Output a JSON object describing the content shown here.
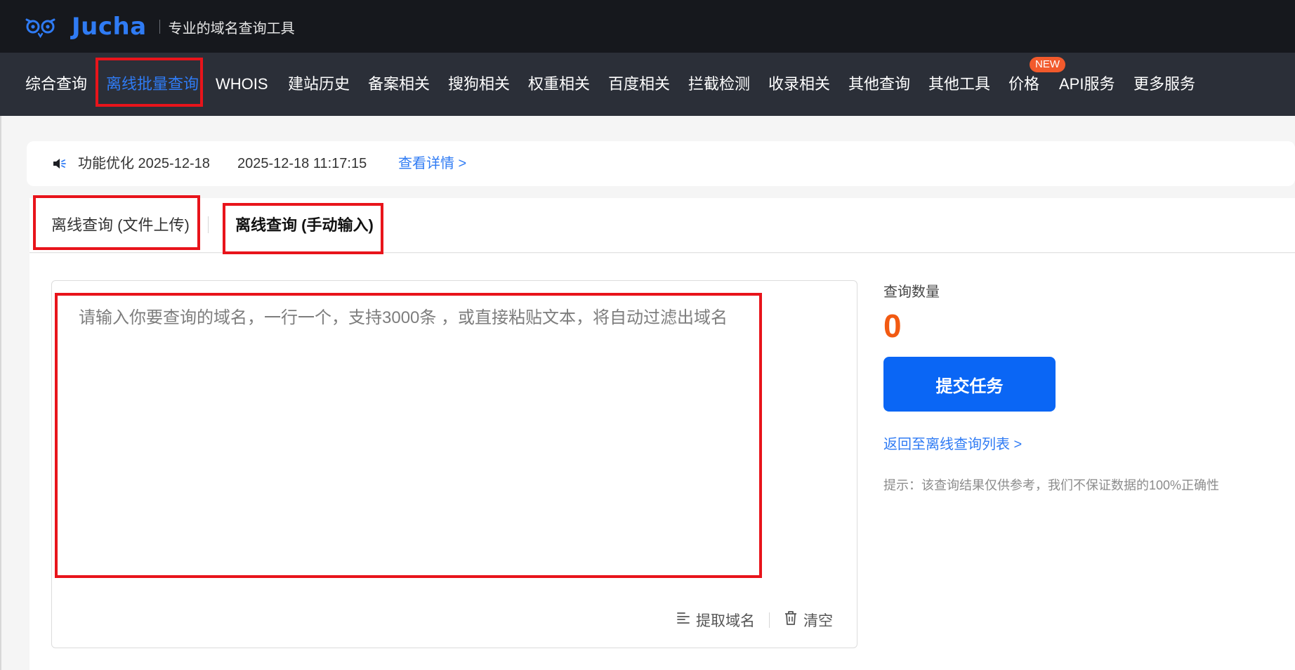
{
  "brand": {
    "name": "Jucha",
    "slogan": "专业的域名查询工具",
    "color": "#2f7bf4"
  },
  "nav": {
    "items": [
      {
        "label": "综合查询",
        "active": false
      },
      {
        "label": "离线批量查询",
        "active": true
      },
      {
        "label": "WHOIS",
        "active": false
      },
      {
        "label": "建站历史",
        "active": false
      },
      {
        "label": "备案相关",
        "active": false
      },
      {
        "label": "搜狗相关",
        "active": false
      },
      {
        "label": "权重相关",
        "active": false
      },
      {
        "label": "百度相关",
        "active": false
      },
      {
        "label": "拦截检测",
        "active": false
      },
      {
        "label": "收录相关",
        "active": false
      },
      {
        "label": "其他查询",
        "active": false
      },
      {
        "label": "其他工具",
        "active": false
      },
      {
        "label": "价格",
        "active": false
      },
      {
        "label": "API服务",
        "active": false
      },
      {
        "label": "更多服务",
        "active": false
      }
    ],
    "badge": "NEW"
  },
  "notice": {
    "icon": "speaker-icon",
    "title": "功能优化 2025-12-18",
    "time": "2025-12-18 11:17:15",
    "link": "查看详情 >"
  },
  "tabs": [
    {
      "label": "离线查询 (文件上传)",
      "selected": false
    },
    {
      "label": "离线查询 (手动输入)",
      "selected": true
    }
  ],
  "input": {
    "placeholder": "请输入你要查询的域名，一行一个，支持3000条 ，或直接粘贴文本，将自动过滤出域名",
    "value": ""
  },
  "actions": {
    "extract": {
      "label": "提取域名",
      "icon": "list-icon"
    },
    "clear": {
      "label": "清空",
      "icon": "trash-icon"
    }
  },
  "side": {
    "count_label": "查询数量",
    "count_value": "0",
    "submit": "提交任务",
    "back_link": "返回至离线查询列表 >",
    "tip": "提示：该查询结果仅供参考，我们不保证数据的100%正确性"
  },
  "colors": {
    "accent": "#2f7bf4",
    "button": "#0a66f5",
    "count": "#f25a12",
    "highlight": "#e8141b",
    "badge": "#f25a2c"
  }
}
